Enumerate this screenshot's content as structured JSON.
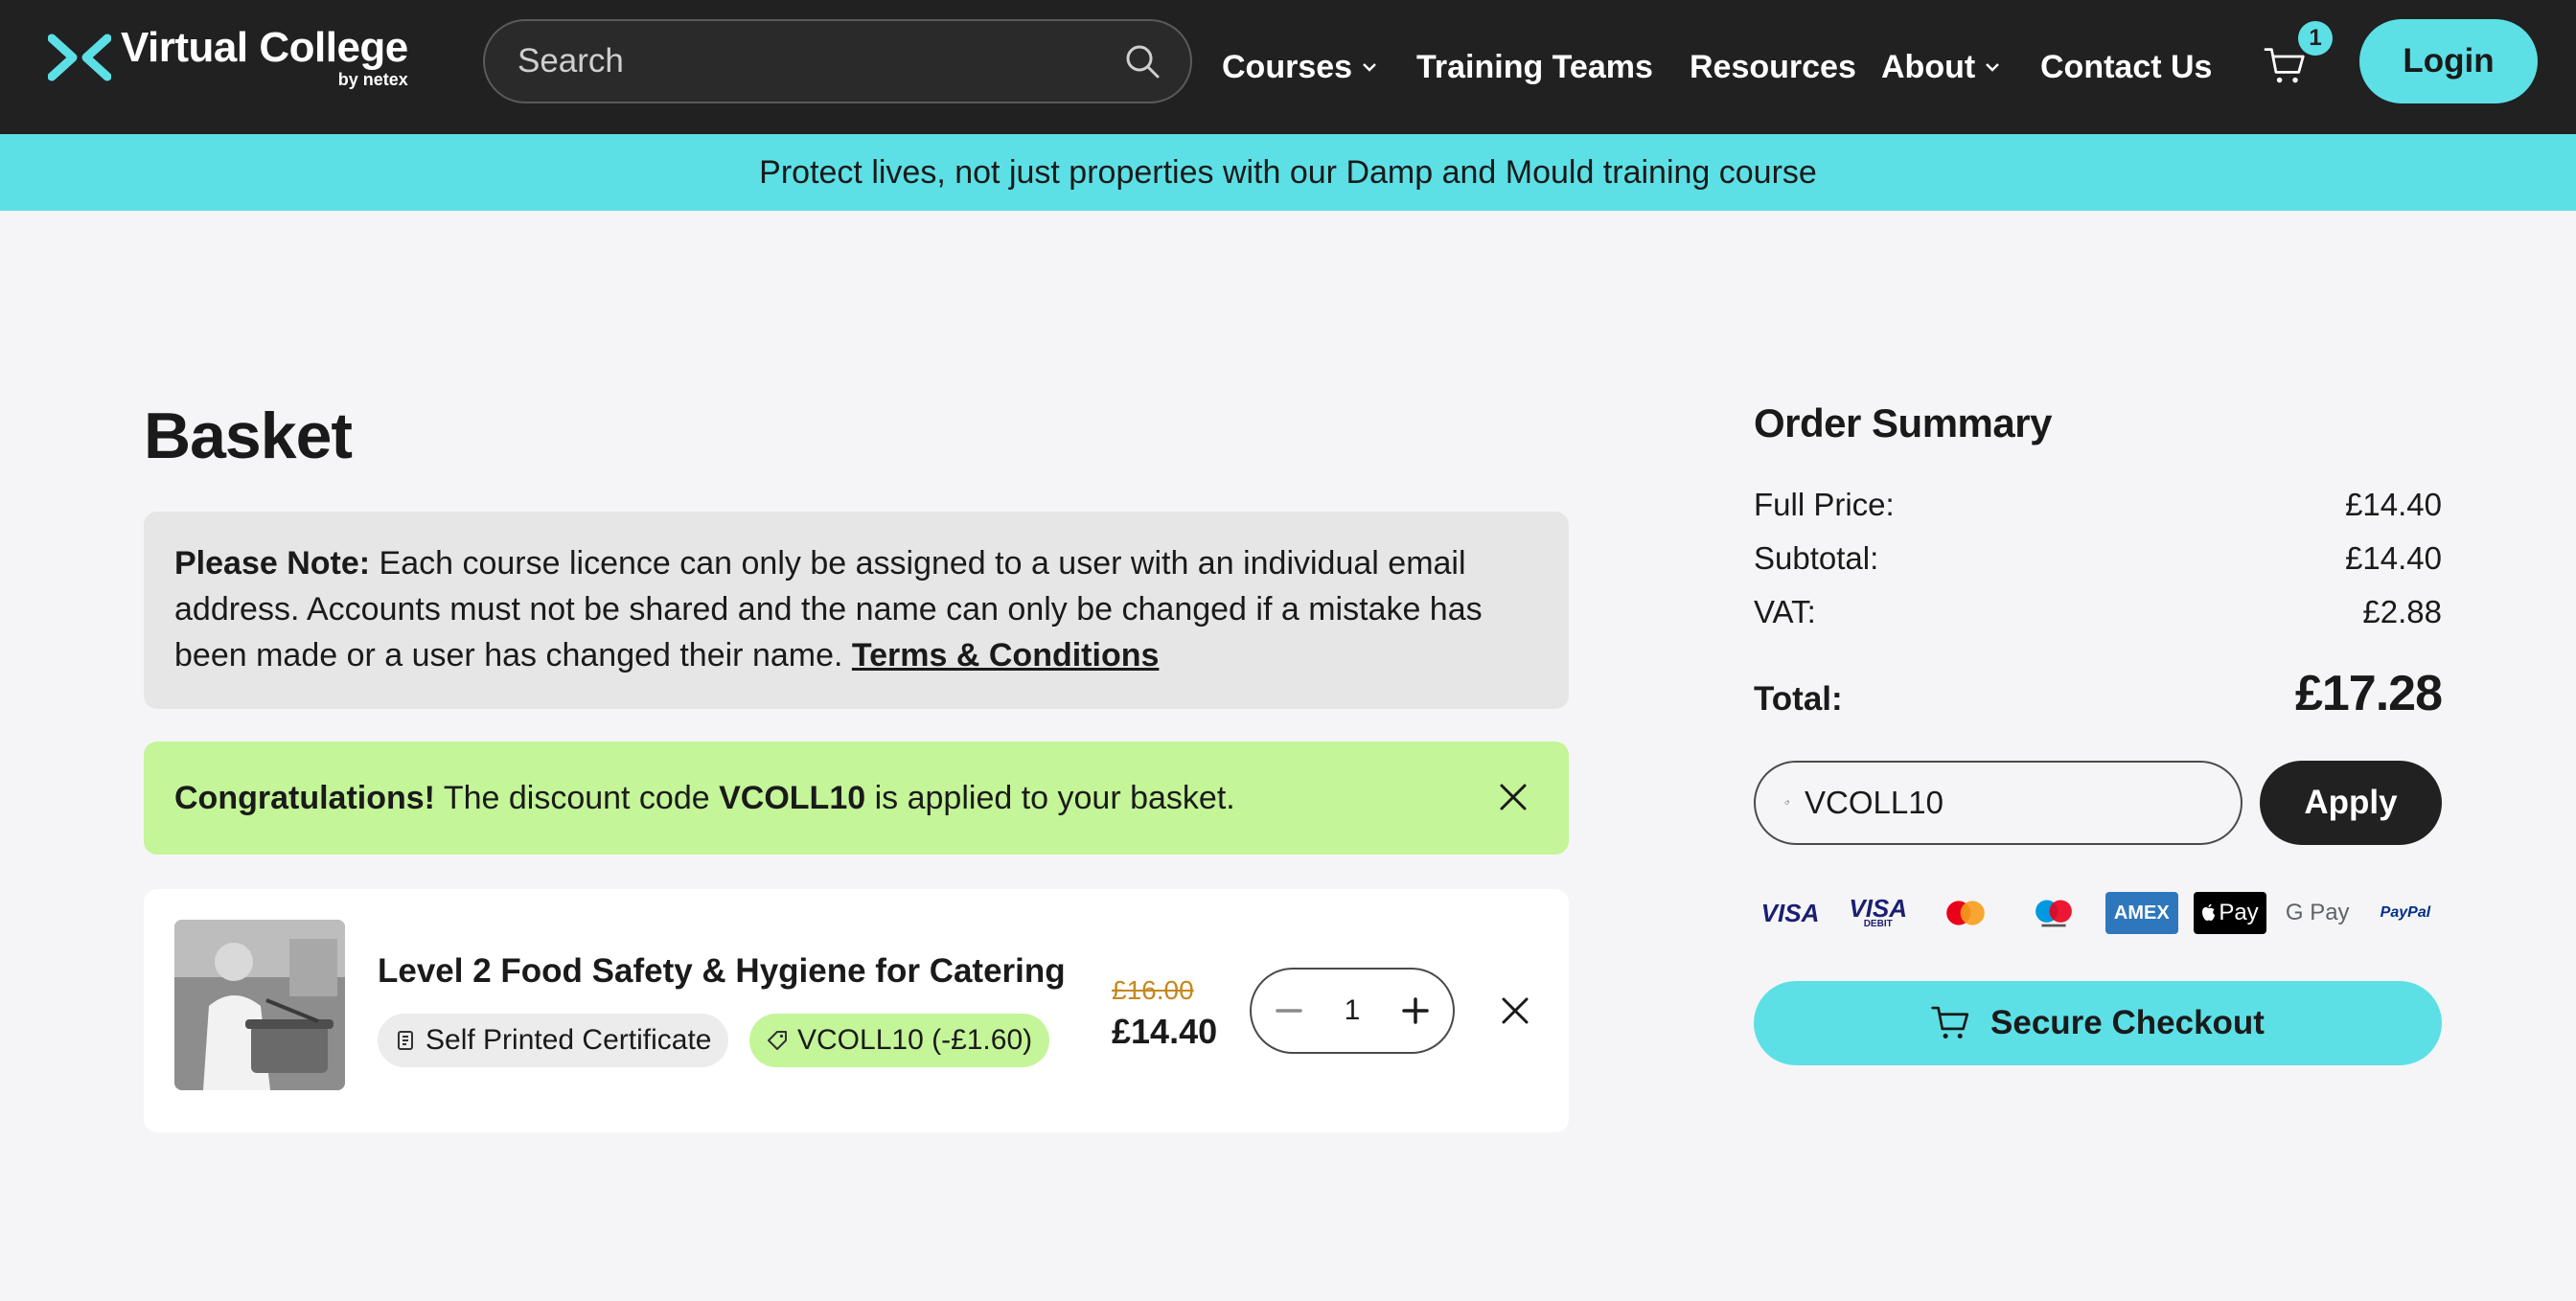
{
  "header": {
    "logo_main": "Virtual College",
    "logo_sub": "by netex",
    "search_placeholder": "Search",
    "nav": {
      "courses": "Courses",
      "training_teams": "Training Teams",
      "resources": "Resources",
      "about": "About",
      "contact": "Contact Us"
    },
    "cart_count": "1",
    "login_label": "Login"
  },
  "banner": {
    "text": "Protect lives, not just properties with our Damp and Mould training course"
  },
  "basket": {
    "title": "Basket",
    "note": {
      "lead": "Please Note:",
      "body": " Each course licence can only be assigned to a user with an individual email address. Accounts must not be shared and the name can only be changed if a mistake has been made or a user has changed their name. ",
      "link": "Terms & Conditions"
    },
    "congrats": {
      "lead": "Congratulations!",
      "pre": " The discount code ",
      "code": "VCOLL10",
      "post": " is applied to your basket."
    },
    "item": {
      "title": "Level 2 Food Safety & Hygiene for Catering",
      "cert_tag": "Self Printed Certificate",
      "discount_tag": "VCOLL10 (-£1.60)",
      "old_price": "£16.00",
      "price": "£14.40",
      "quantity": "1"
    }
  },
  "summary": {
    "title": "Order Summary",
    "rows": [
      {
        "label": "Full Price:",
        "value": "£14.40"
      },
      {
        "label": "Subtotal:",
        "value": "£14.40"
      },
      {
        "label": "VAT:",
        "value": "£2.88"
      }
    ],
    "total_label": "Total:",
    "total_value": "£17.28",
    "code_value": "VCOLL10",
    "apply_label": "Apply",
    "payments": [
      "VISA",
      "VISA",
      "Mastercard",
      "Maestro",
      "AMEX",
      "Pay",
      "G Pay",
      "PayPal"
    ],
    "visa_debit_label": "DEBIT",
    "checkout_label": "Secure Checkout"
  },
  "colors": {
    "header_bg": "#212121",
    "accent_cyan": "#5ce0e6",
    "success_green": "#c4f598",
    "note_grey": "#e6e6e6",
    "old_price_gold": "#c5881d"
  }
}
